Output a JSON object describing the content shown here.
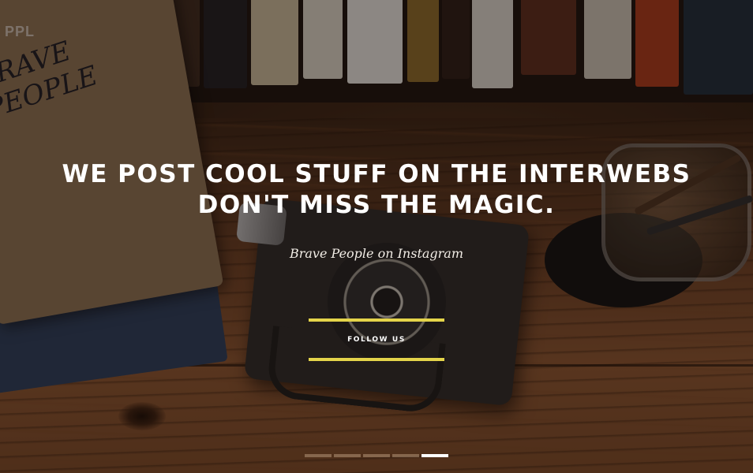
{
  "brand": {
    "corner_text": "PPL"
  },
  "notebook": {
    "handwriting": "BRAVE PEOPLE"
  },
  "hero": {
    "headline_line1": "WE POST COOL STUFF ON THE INTERWEBS",
    "headline_line2": "DON'T MISS THE MAGIC.",
    "subtitle": "Brave People on Instagram",
    "follow_label": "FOLLOW US"
  },
  "slider": {
    "total_slides": 5,
    "active_index": 4
  },
  "colors": {
    "accent": "#e4d44a",
    "text": "#ffffff"
  }
}
